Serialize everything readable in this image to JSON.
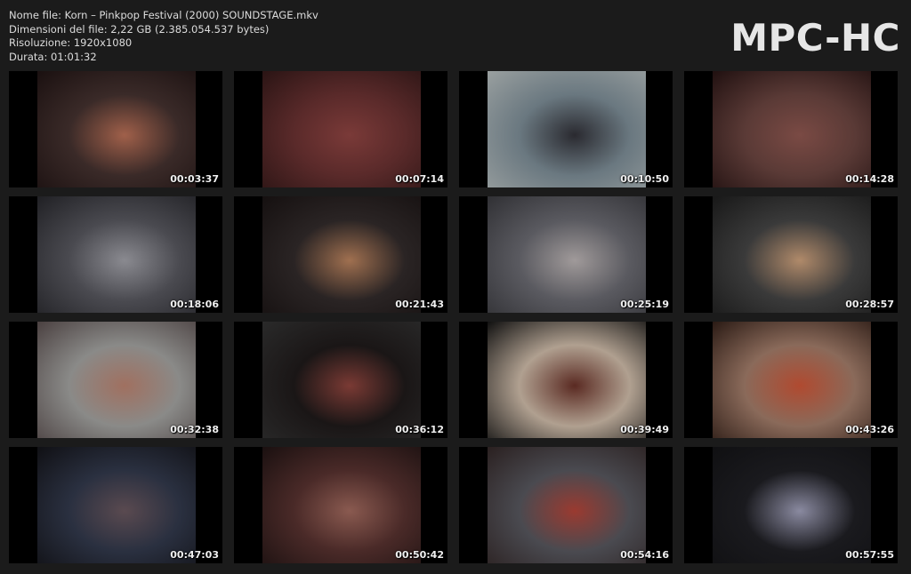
{
  "file_info": {
    "name": "Nome file: Korn – Pinkpop Festival (2000) SOUNDSTAGE.mkv",
    "size": "Dimensioni del file: 2,22 GB (2.385.054.537 bytes)",
    "resolution": "Risoluzione: 1920x1080",
    "duration": "Durata: 01:01:32"
  },
  "logo": "MPC-HC",
  "thumbnails": [
    {
      "time": "00:03:37",
      "colors": [
        "#3a2a28",
        "#a0604a",
        "#1a1010"
      ]
    },
    {
      "time": "00:07:14",
      "colors": [
        "#5a2a2a",
        "#7a3a38",
        "#2a1414"
      ]
    },
    {
      "time": "00:10:50",
      "colors": [
        "#6a7880",
        "#2a2a30",
        "#9aa0a0"
      ]
    },
    {
      "time": "00:14:28",
      "colors": [
        "#5a3a36",
        "#7a4a44",
        "#201010"
      ]
    },
    {
      "time": "00:18:06",
      "colors": [
        "#4a4a50",
        "#8a8a90",
        "#202024"
      ]
    },
    {
      "time": "00:21:43",
      "colors": [
        "#2a2424",
        "#a07050",
        "#151010"
      ]
    },
    {
      "time": "00:25:19",
      "colors": [
        "#5a5a60",
        "#a09a9a",
        "#303034"
      ]
    },
    {
      "time": "00:28:57",
      "colors": [
        "#3a3a3a",
        "#b08a6a",
        "#181818"
      ]
    },
    {
      "time": "00:32:38",
      "colors": [
        "#8a8a88",
        "#a07060",
        "#4a4040"
      ]
    },
    {
      "time": "00:36:12",
      "colors": [
        "#1a1616",
        "#7a3a34",
        "#2a2a2a"
      ]
    },
    {
      "time": "00:39:49",
      "colors": [
        "#b0a090",
        "#5a2a22",
        "#101010"
      ]
    },
    {
      "time": "00:43:26",
      "colors": [
        "#8a6a5a",
        "#b04a30",
        "#2a1a14"
      ]
    },
    {
      "time": "00:47:03",
      "colors": [
        "#2a3040",
        "#5a4a50",
        "#101014"
      ]
    },
    {
      "time": "00:50:42",
      "colors": [
        "#4a2a28",
        "#8a5a50",
        "#1a1010"
      ]
    },
    {
      "time": "00:54:16",
      "colors": [
        "#4a4a50",
        "#9a3a30",
        "#2a2020"
      ]
    },
    {
      "time": "00:57:55",
      "colors": [
        "#1a1a1e",
        "#8a8aa0",
        "#101012"
      ]
    }
  ]
}
